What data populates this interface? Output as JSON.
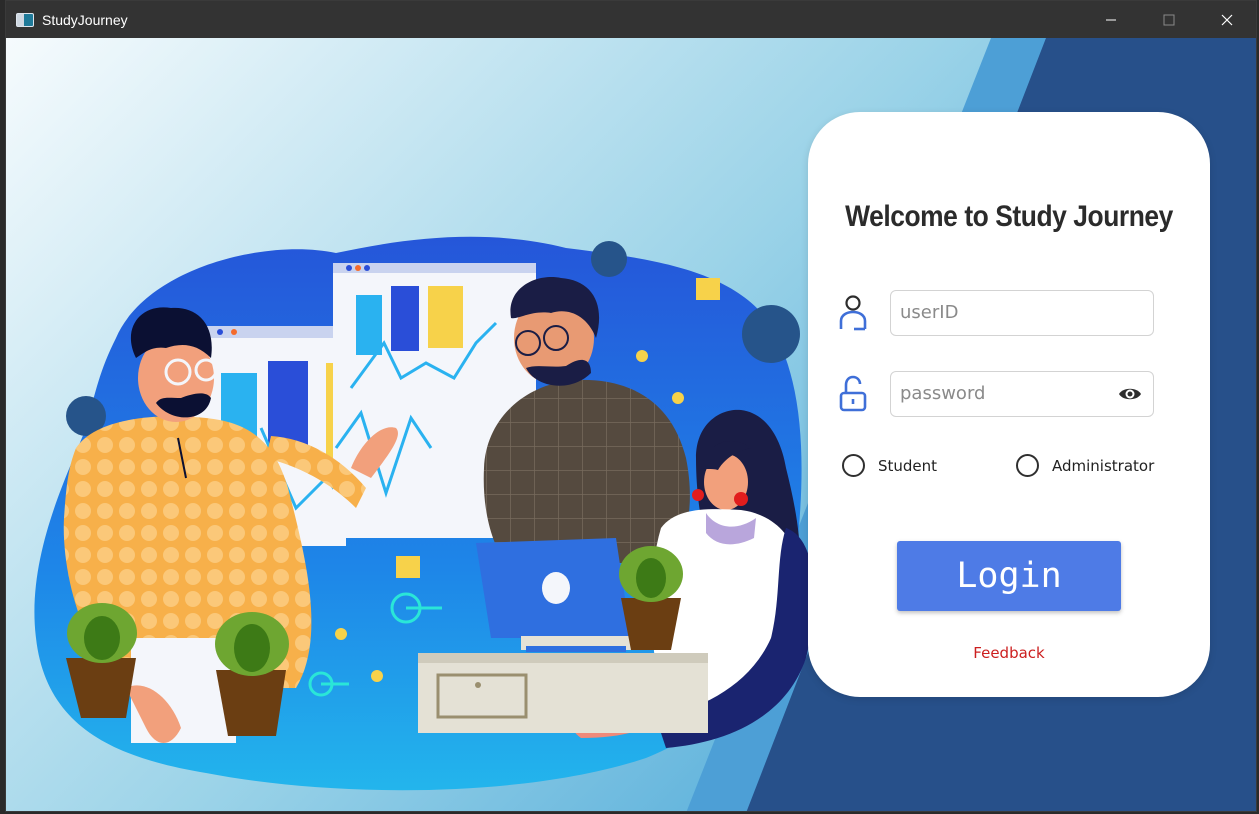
{
  "window": {
    "title": "StudyJourney",
    "controls": [
      "minimize",
      "maximize",
      "close"
    ]
  },
  "login": {
    "welcome_text": "Welcome to Study Journey",
    "userid_placeholder": "userID",
    "userid_value": "",
    "password_placeholder": "password",
    "password_value": "",
    "roles": [
      "Student",
      "Administrator"
    ],
    "selected_role": null,
    "login_label": "Login",
    "feedback_label": "Feedback"
  },
  "icons": {
    "user_field": "user-icon",
    "password_field": "unlock-icon",
    "password_toggle": "eye-icon"
  },
  "colors": {
    "title_bar": "#333333",
    "login_button": "#4e7be6",
    "feedback_link": "#cc1f1f",
    "field_icon": "#3f6fd8",
    "background_dark_blue": "#27508a",
    "background_mid_blue": "#4a9fd6"
  }
}
